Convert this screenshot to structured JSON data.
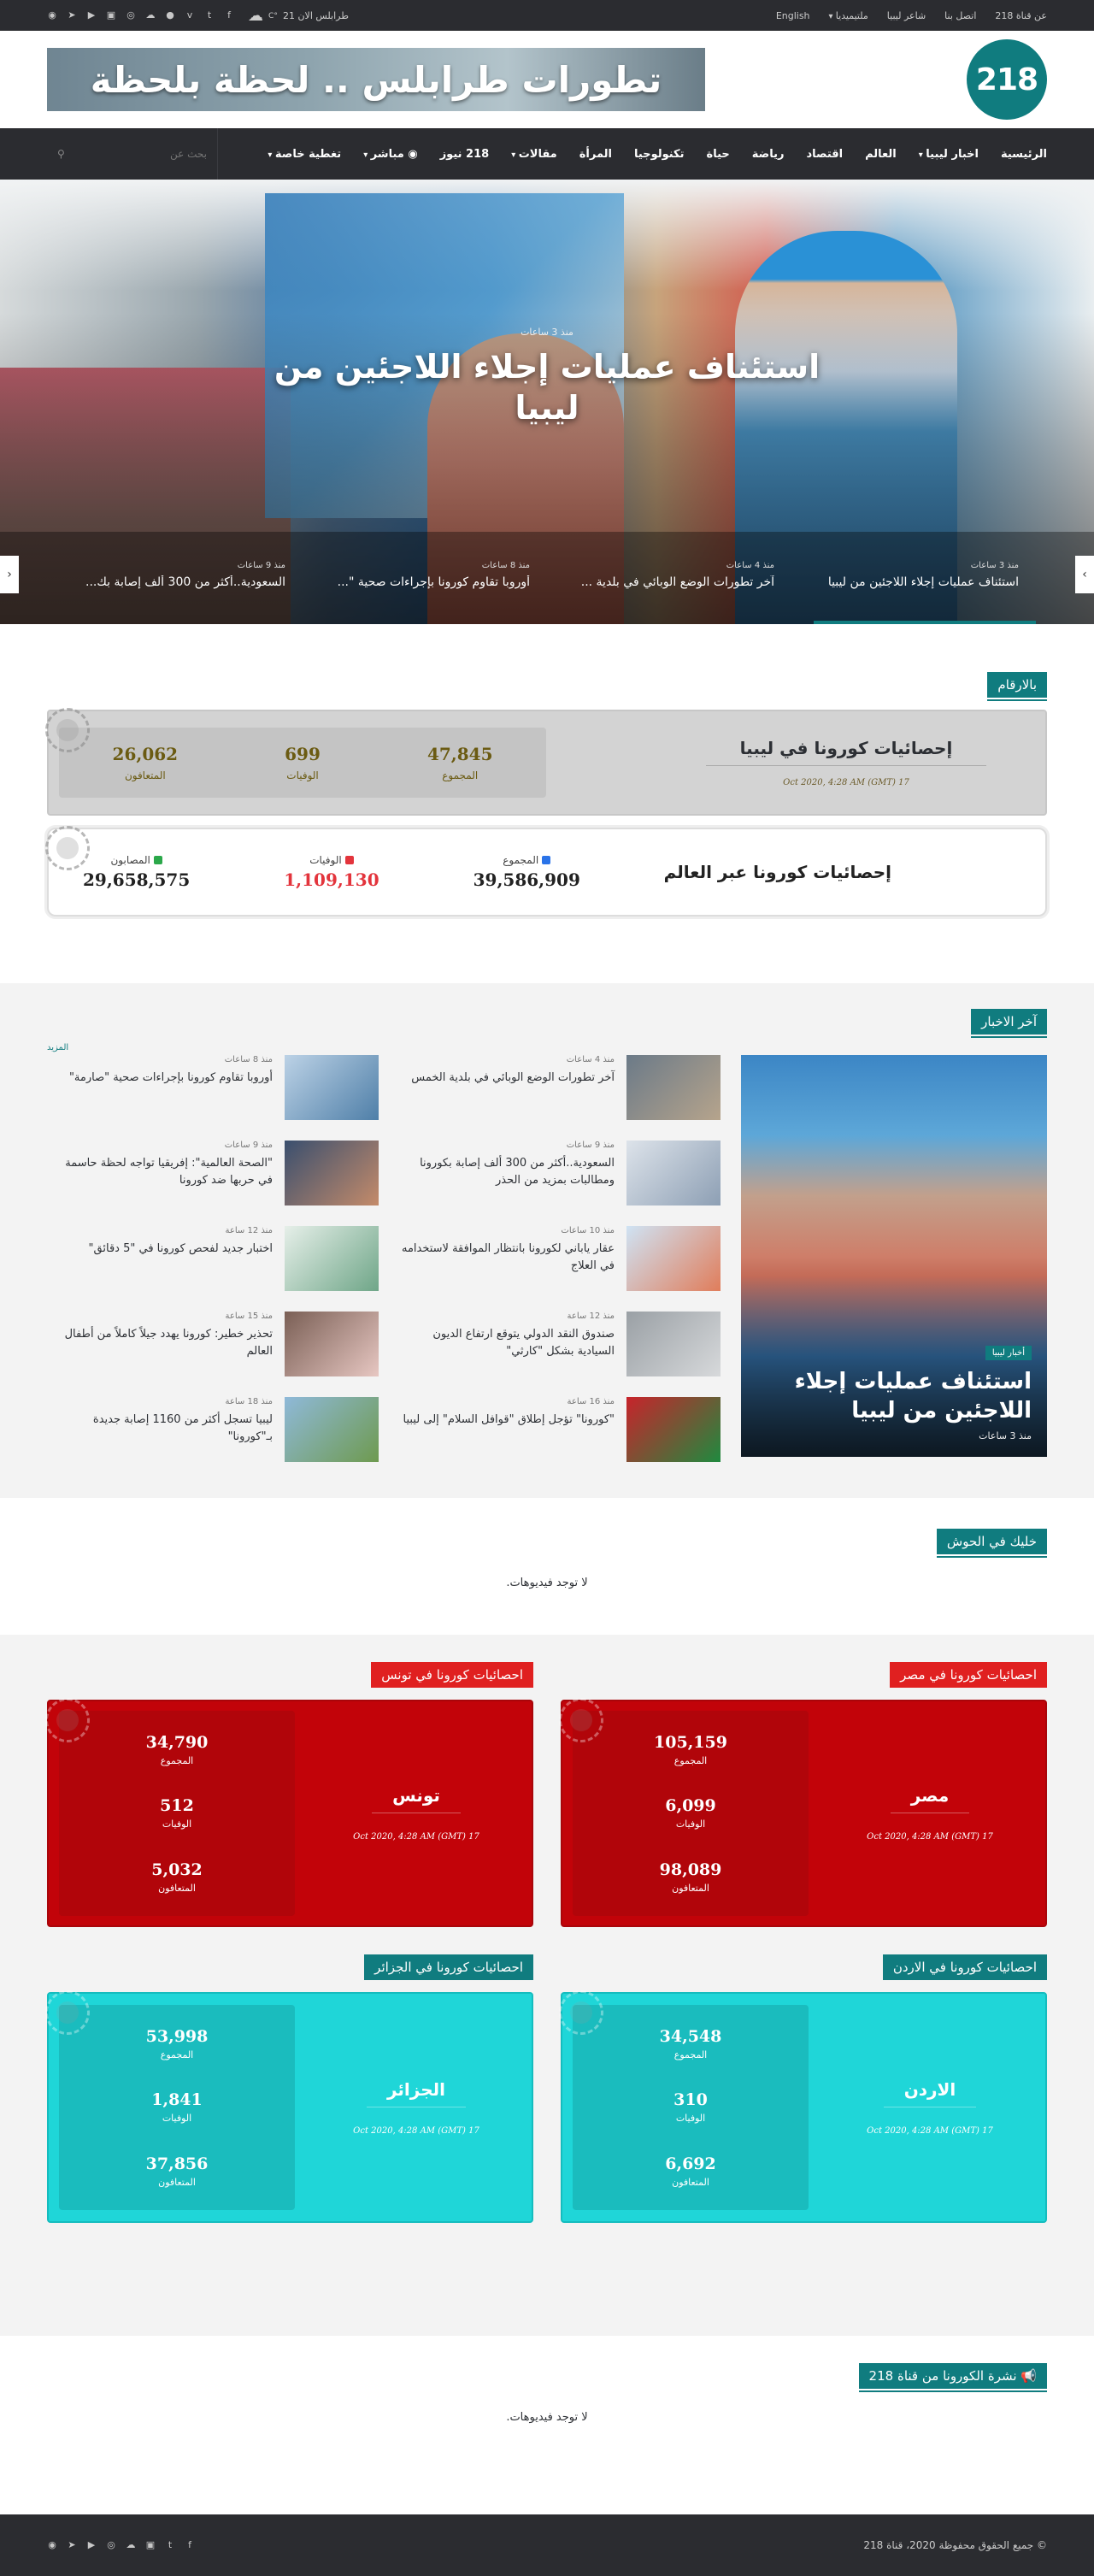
{
  "topbar": {
    "nav": [
      "عن قناة 218",
      "اتصل بنا",
      "شاعر ليبيا",
      "ملتيميديا",
      "English"
    ],
    "weather": "طرابلس الان 21",
    "weather_unit": "°C",
    "socials": [
      "facebook-icon",
      "twitter-icon",
      "vimeo-icon",
      "apple-icon",
      "soundcloud-icon",
      "instagram-icon",
      "youtube-icon",
      "play-icon",
      "telegram-icon",
      "rss-icon"
    ]
  },
  "header": {
    "logo": "218",
    "banner": "تطورات طرابلس .. لحظة بلحظة"
  },
  "menu": [
    "الرئيسية",
    "اخبار ليبيا",
    "العالم",
    "اقتصاد",
    "رياضة",
    "حياة",
    "تكنولوجيا",
    "المرأة",
    "مقالات",
    "218 نيوز",
    "مباشر",
    "تغطية خاصة"
  ],
  "search": {
    "placeholder": "بحث عن"
  },
  "hero": {
    "ago": "منذ 3 ساعات",
    "title": "استئناف عمليات إجلاء اللاجئين من ليبيا",
    "slides": [
      {
        "ago": "منذ 3 ساعات",
        "title": "استئناف عمليات إجلاء اللاجئين من ليبيا"
      },
      {
        "ago": "منذ 4 ساعات",
        "title": "آخر تطورات الوضع الوبائي في بلدية ..."
      },
      {
        "ago": "منذ 8 ساعات",
        "title": "أوروبا تقاوم كورونا بإجراءات صحية \"..."
      },
      {
        "ago": "منذ 9 ساعات",
        "title": "السعودية..أكثر من 300 ألف إصابة بك..."
      }
    ]
  },
  "numbers": {
    "title": "بالارقام",
    "libya": {
      "title": "إحصائيات كورونا في ليبيا",
      "date": "17 Oct 2020, 4:28 AM (GMT)",
      "total": "47,845",
      "total_label": "المجموع",
      "deaths": "699",
      "deaths_label": "الوفيات",
      "recovered": "26,062",
      "recovered_label": "المتعافون"
    },
    "world": {
      "title": "إحصائيات كورونا عبر العالم",
      "total": "39,586,909",
      "total_label": "المجموع",
      "deaths": "1,109,130",
      "deaths_label": "الوفيات",
      "infected": "29,658,575",
      "infected_label": "المصابون",
      "colors": {
        "total": "#2a73e8",
        "deaths": "#e3343c",
        "infected": "#2ba84a"
      }
    }
  },
  "latest": {
    "title": "آخر الاخبار",
    "more": "المزيد",
    "featured": {
      "tag": "أخبار ليبيا",
      "title": "استئناف عمليات إجلاء اللاجئين من ليبيا",
      "ago": "منذ 3 ساعات"
    },
    "col1": [
      {
        "ago": "منذ 4 ساعات",
        "title": "آخر تطورات الوضع الوبائي في بلدية الخمس"
      },
      {
        "ago": "منذ 9 ساعات",
        "title": "السعودية..أكثر من 300 ألف إصابة بكورونا ومطالبات بمزيد من الحذر"
      },
      {
        "ago": "منذ 10 ساعات",
        "title": "عقار ياباني لكورونا بانتظار الموافقة لاستخدامه في العلاج"
      },
      {
        "ago": "منذ 12 ساعة",
        "title": "صندوق النقد الدولي يتوقع ارتفاع الديون السيادية بشكل \"كارثي\""
      },
      {
        "ago": "منذ 16 ساعة",
        "title": "\"كورونا\" تؤجل إطلاق \"قوافل السلام\" إلى ليبيا"
      }
    ],
    "col2": [
      {
        "ago": "منذ 8 ساعات",
        "title": "أوروبا تقاوم كورونا بإجراءات صحية \"صارمة\""
      },
      {
        "ago": "منذ 9 ساعات",
        "title": "\"الصحة العالمية\": إفريقيا تواجه لحظة حاسمة في حربها ضد كورونا"
      },
      {
        "ago": "منذ 12 ساعة",
        "title": "اختبار جديد لفحص كورونا في \"5 دقائق\""
      },
      {
        "ago": "منذ 15 ساعة",
        "title": "تحذير خطير: كورونا يهدد جيلاً كاملاً من أطفال العالم"
      },
      {
        "ago": "منذ 18 ساعة",
        "title": "ليبيا تسجل أكثر من 1160 إصابة جديدة بـ\"كورونا\""
      }
    ]
  },
  "video1": {
    "title": "خليك في الحوش",
    "empty": "لا توجد فيديوهات."
  },
  "countries": [
    {
      "theme": "red",
      "head": "احصائيات كورونا في مصر",
      "name": "مصر",
      "date": "17 Oct 2020, 4:28 AM (GMT)",
      "total": "105,159",
      "deaths": "6,099",
      "recovered": "98,089"
    },
    {
      "theme": "red",
      "head": "احصائيات كورونا في تونس",
      "name": "تونس",
      "date": "17 Oct 2020, 4:28 AM (GMT)",
      "total": "34,790",
      "deaths": "512",
      "recovered": "5,032"
    },
    {
      "theme": "cyan",
      "head": "احصائيات كورونا في الاردن",
      "name": "الاردن",
      "date": "17 Oct 2020, 4:28 AM (GMT)",
      "total": "34,548",
      "deaths": "310",
      "recovered": "6,692"
    },
    {
      "theme": "cyan",
      "head": "احصائيات كورونا في الجزائر",
      "name": "الجزائر",
      "date": "17 Oct 2020, 4:28 AM (GMT)",
      "total": "53,998",
      "deaths": "1,841",
      "recovered": "37,856"
    }
  ],
  "labels": {
    "total": "المجموع",
    "deaths": "الوفيات",
    "recovered": "المتعافون"
  },
  "video2": {
    "title": "نشرة الكورونا من قناة 218",
    "empty": "لا توجد فيديوهات."
  },
  "footer": {
    "copyright": "© جميع الحقوق محفوظة 2020، قناة 218"
  }
}
